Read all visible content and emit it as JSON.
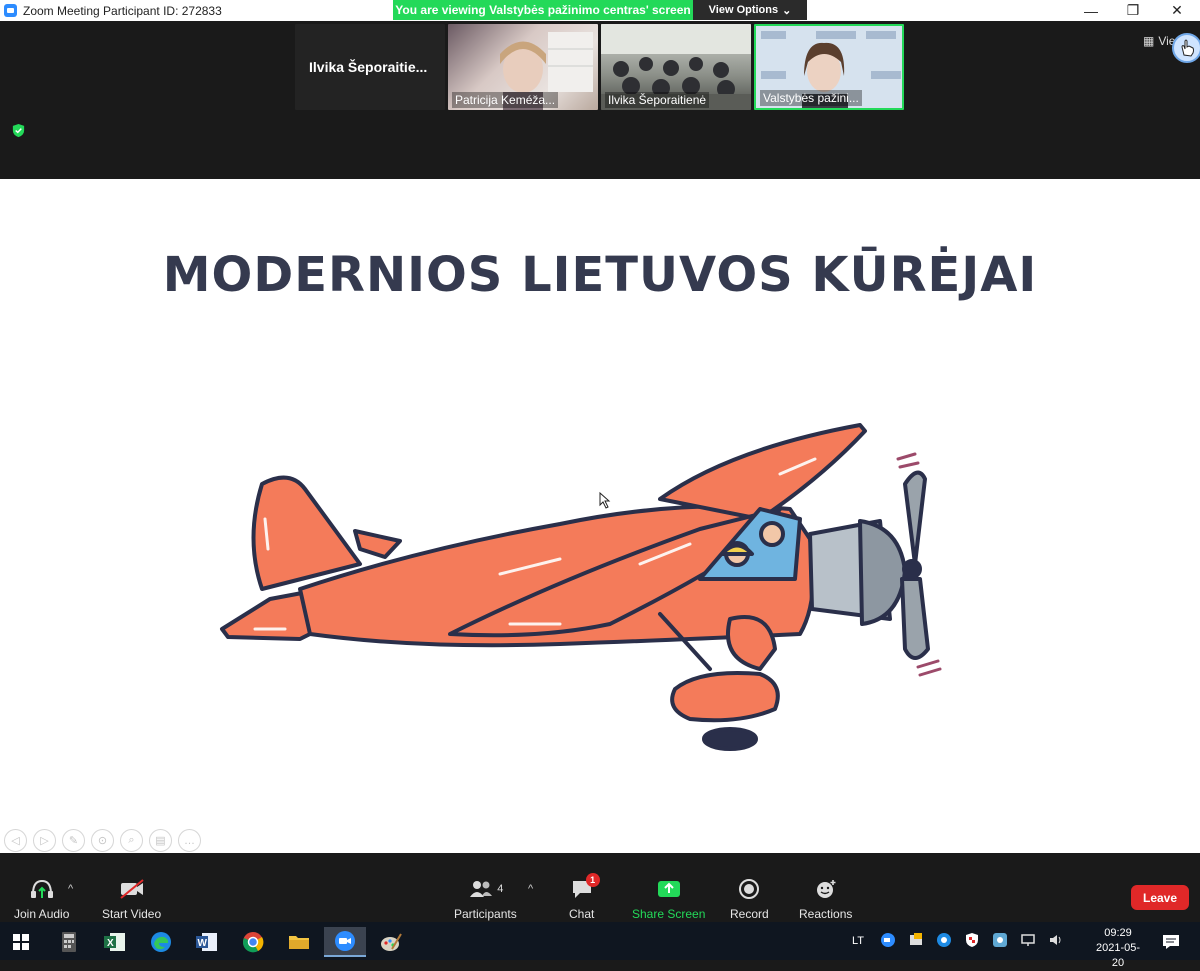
{
  "window": {
    "title": "Zoom Meeting Participant ID: 272833",
    "minimize": "—",
    "restore": "❐",
    "close": "✕"
  },
  "share_banner": {
    "text": "You are viewing Valstybės pažinimo centras' screen",
    "view_options": "View Options"
  },
  "participants_strip": [
    {
      "name": "Ilvika  Šeporaitie...",
      "type": "name-only"
    },
    {
      "name": "Patricija Keméža...",
      "type": "video"
    },
    {
      "name": "Ilvika Šeporaitienė",
      "type": "video"
    },
    {
      "name": "Valstybės pažini...",
      "type": "video"
    }
  ],
  "view_label": "Vie",
  "slide": {
    "title": "MODERNIOS LIETUVOS KŪRĖJAI"
  },
  "controls": {
    "join_audio": "Join Audio",
    "start_video": "Start Video",
    "participants": "Participants",
    "participants_count": "4",
    "chat": "Chat",
    "chat_badge": "1",
    "share_screen": "Share Screen",
    "record": "Record",
    "reactions": "Reactions",
    "leave": "Leave"
  },
  "taskbar": {
    "language": "LT",
    "time": "09:29",
    "date": "2021-05-20"
  },
  "colors": {
    "banner_green": "#23d959",
    "leave_red": "#e02828",
    "plane_orange": "#f47b5a",
    "outline_navy": "#2a2f4a",
    "title_navy": "#353a4f"
  }
}
